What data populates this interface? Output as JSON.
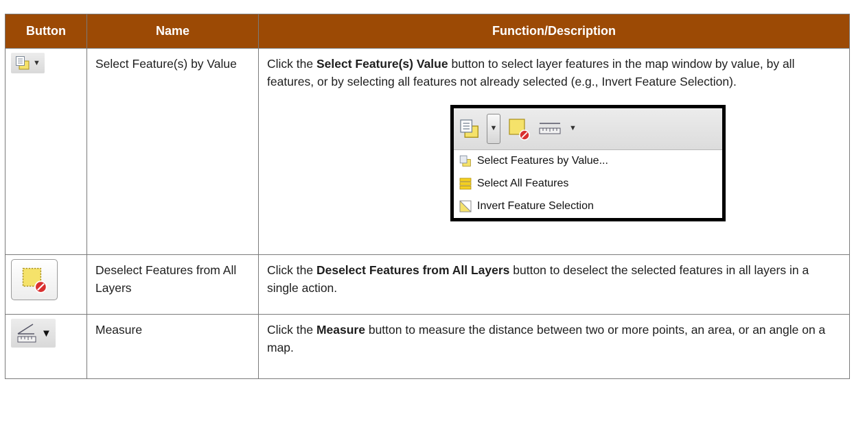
{
  "header": {
    "button": "Button",
    "name": "Name",
    "function": "Function/Description"
  },
  "rows": [
    {
      "icon": "select-by-value-icon",
      "name": "Select Feature(s) by Value",
      "desc_pre": "Click the ",
      "desc_bold": "Select Feature(s) Value",
      "desc_post": " button to select layer features in the map window by value, by all features, or by selecting all features not already selected (e.g., Invert Feature Selection)."
    },
    {
      "icon": "deselect-features-icon",
      "name": "Deselect Features from All Layers",
      "desc_pre": "Click the ",
      "desc_bold": "Deselect Features from All Layers",
      "desc_post": " button to deselect the selected features in all layers in a single action."
    },
    {
      "icon": "measure-icon",
      "name": "Measure",
      "desc_pre": "Click the ",
      "desc_bold": "Measure",
      "desc_post": " button to measure the distance between two or more points, an area, or an angle on a map."
    }
  ],
  "inset_menu": {
    "items": [
      {
        "label": "Select Features by Value...",
        "icon": "select-by-value-icon"
      },
      {
        "label": "Select All Features",
        "icon": "select-all-icon"
      },
      {
        "label": "Invert Feature Selection",
        "icon": "invert-selection-icon"
      }
    ]
  },
  "colors": {
    "header_bg": "#9c4a05",
    "header_text": "#ffffff",
    "select_yellow": "#f5e26a",
    "deselect_red": "#d93030"
  }
}
